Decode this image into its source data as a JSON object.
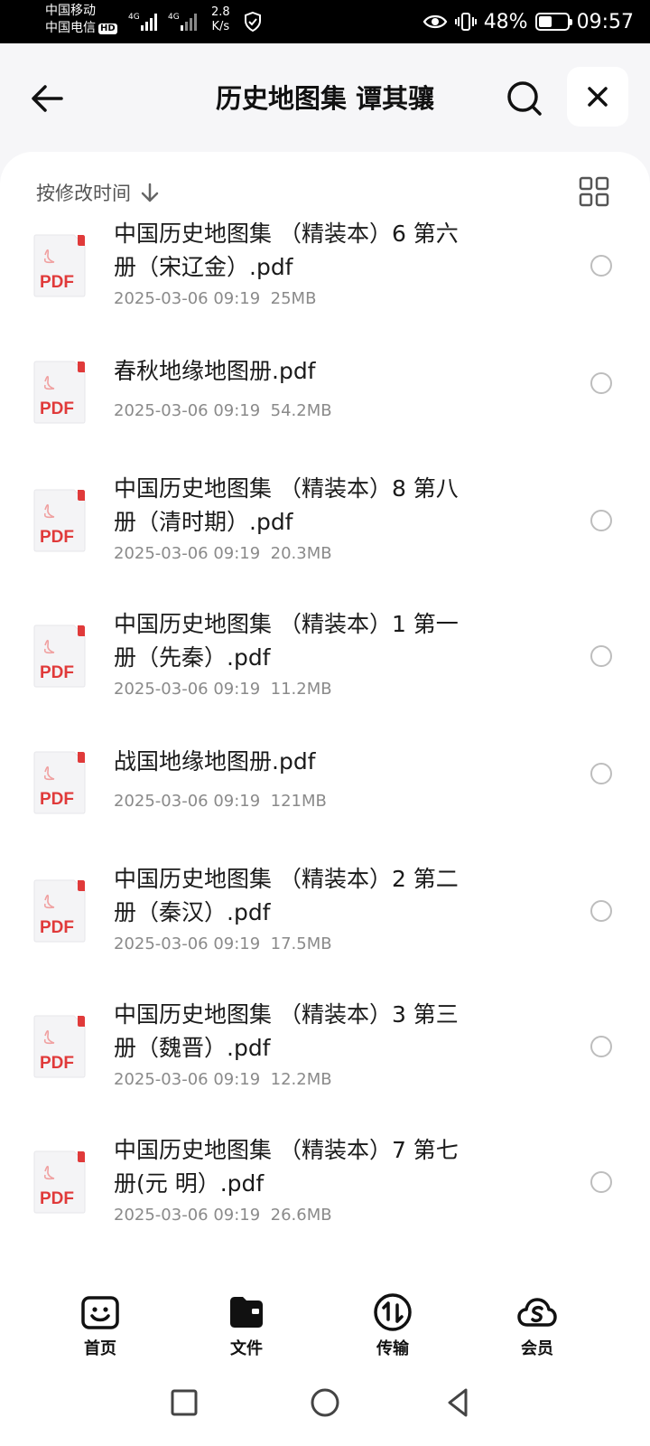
{
  "status_bar": {
    "carrier_1": "中国移动",
    "carrier_2": "中国电信",
    "hd": "HD",
    "network_1": "4G",
    "network_2": "4G",
    "speed_value": "2.8",
    "speed_unit": "K/s",
    "battery": "48%",
    "battery_level": 0.48,
    "time": "09:57"
  },
  "header": {
    "title": "历史地图集 谭其骧"
  },
  "sort": {
    "label": "按修改时间"
  },
  "files": [
    {
      "line1": "中国历史地图集 （精装本）6 第六",
      "line2": "册（宋辽金）.pdf",
      "meta": "2025-03-06 09:19  25MB",
      "icon_label": "PDF"
    },
    {
      "line1": "春秋地缘地图册.pdf",
      "line2": "",
      "meta": "2025-03-06 09:19  54.2MB",
      "icon_label": "PDF"
    },
    {
      "line1": "中国历史地图集 （精装本）8 第八",
      "line2": "册（清时期）.pdf",
      "meta": "2025-03-06 09:19  20.3MB",
      "icon_label": "PDF"
    },
    {
      "line1": "中国历史地图集 （精装本）1 第一",
      "line2": "册（先秦）.pdf",
      "meta": "2025-03-06 09:19  11.2MB",
      "icon_label": "PDF"
    },
    {
      "line1": "战国地缘地图册.pdf",
      "line2": "",
      "meta": "2025-03-06 09:19  121MB",
      "icon_label": "PDF"
    },
    {
      "line1": "中国历史地图集 （精装本）2 第二",
      "line2": "册（秦汉）.pdf",
      "meta": "2025-03-06 09:19  17.5MB",
      "icon_label": "PDF"
    },
    {
      "line1": "中国历史地图集 （精装本）3 第三",
      "line2": "册（魏晋）.pdf",
      "meta": "2025-03-06 09:19  12.2MB",
      "icon_label": "PDF"
    },
    {
      "line1": "中国历史地图集 （精装本）7 第七",
      "line2": "册(元 明）.pdf",
      "meta": "2025-03-06 09:19  26.6MB",
      "icon_label": "PDF"
    }
  ],
  "bottom_nav": {
    "home": "首页",
    "files": "文件",
    "transfer": "传输",
    "member": "会员"
  },
  "colors": {
    "pdf_red": "#e03a3a",
    "background": "#f6f6f8",
    "meta_gray": "#8a8a8a"
  }
}
